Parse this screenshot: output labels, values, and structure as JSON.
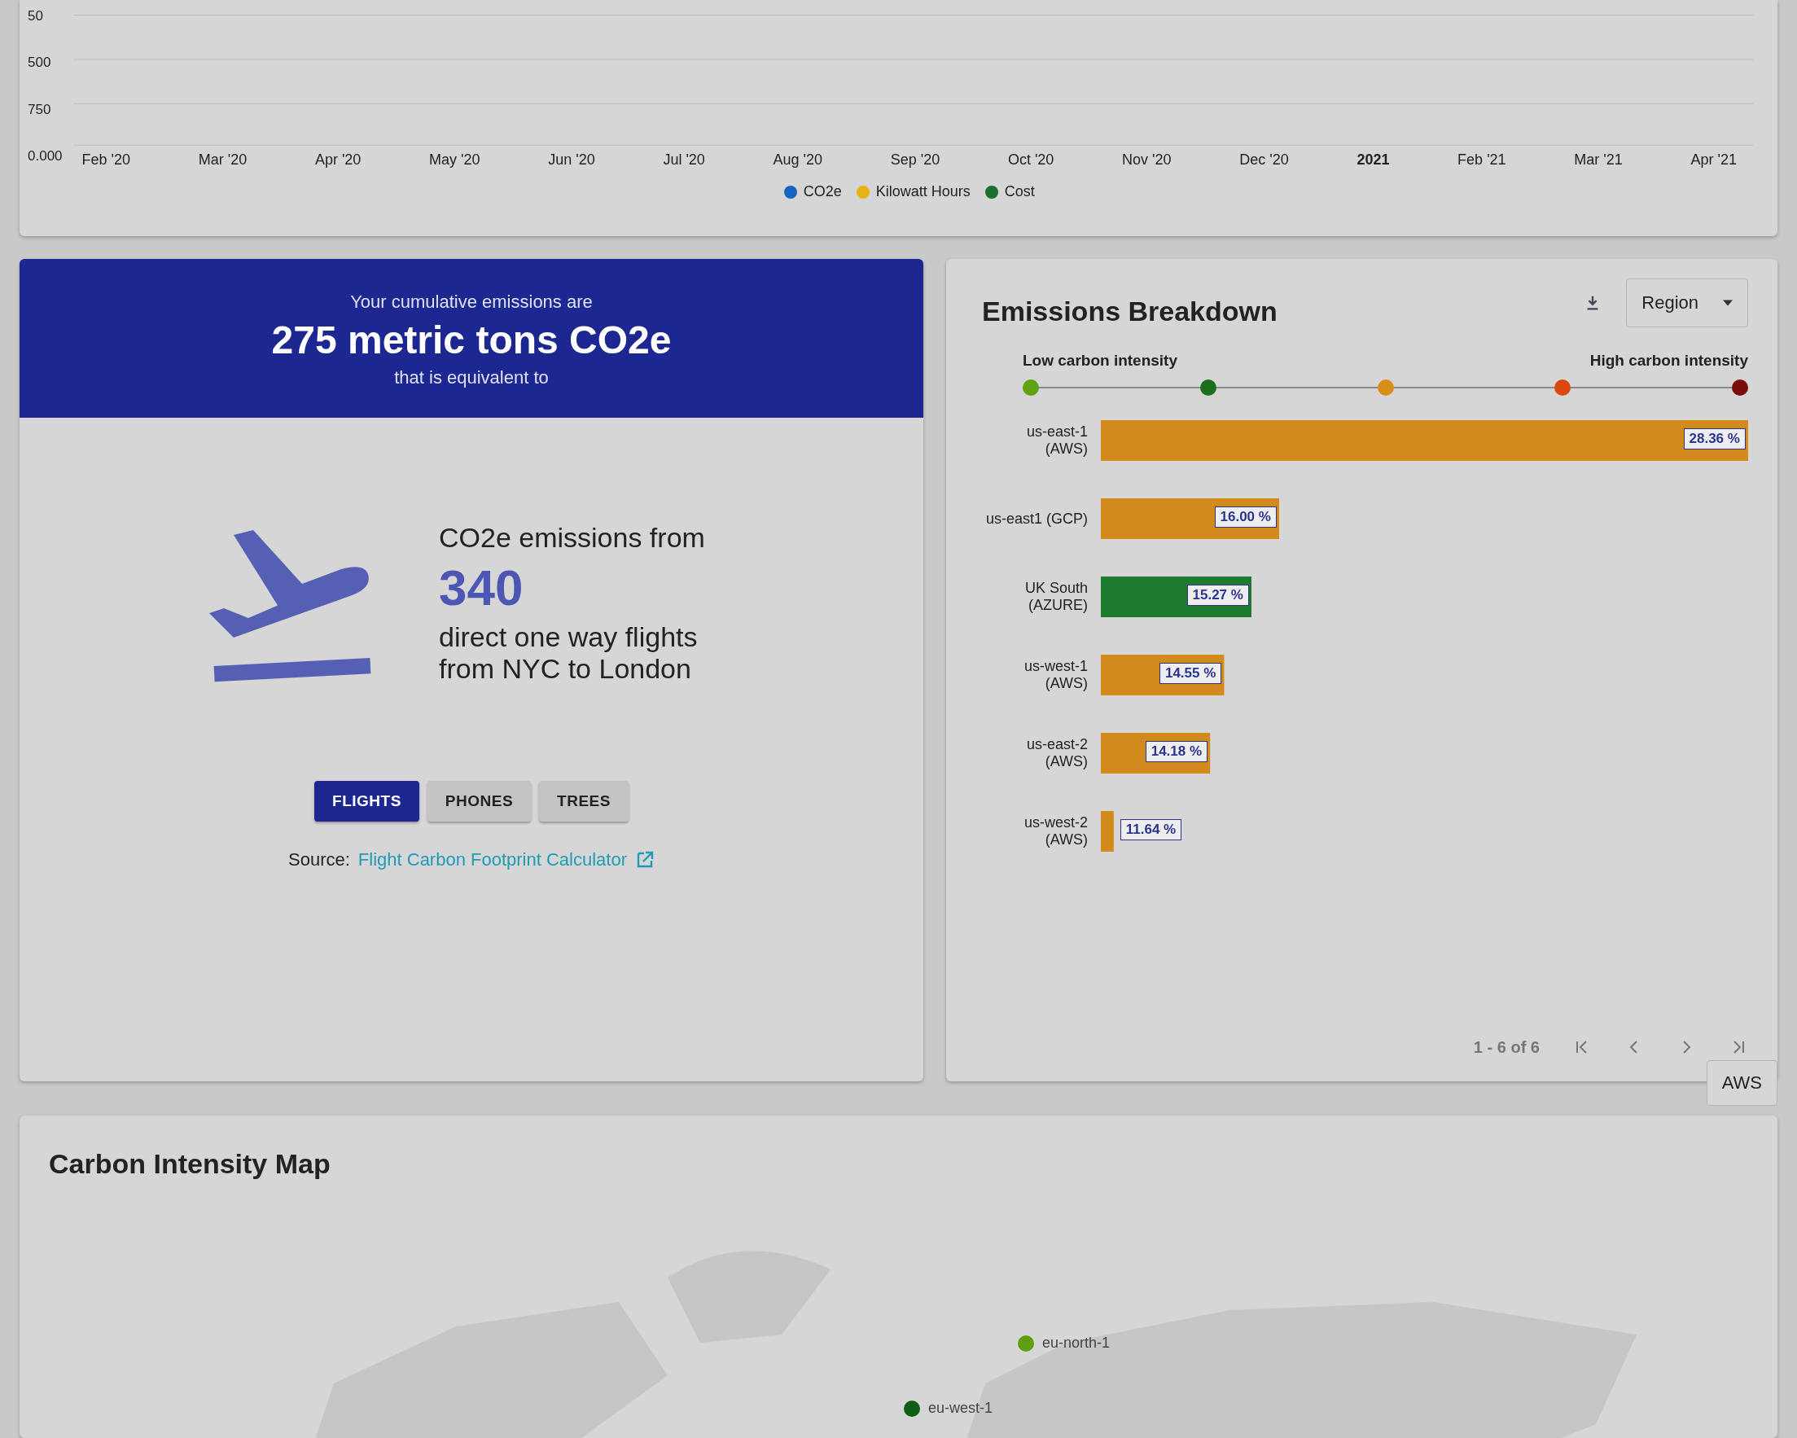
{
  "trend_chart": {
    "y_labels": [
      "50",
      "500",
      "750",
      "0.000"
    ],
    "x_labels": [
      {
        "text": "Feb '20",
        "bold": false
      },
      {
        "text": "Mar '20",
        "bold": false
      },
      {
        "text": "Apr '20",
        "bold": false
      },
      {
        "text": "May '20",
        "bold": false
      },
      {
        "text": "Jun '20",
        "bold": false
      },
      {
        "text": "Jul '20",
        "bold": false
      },
      {
        "text": "Aug '20",
        "bold": false
      },
      {
        "text": "Sep '20",
        "bold": false
      },
      {
        "text": "Oct '20",
        "bold": false
      },
      {
        "text": "Nov '20",
        "bold": false
      },
      {
        "text": "Dec '20",
        "bold": false
      },
      {
        "text": "2021",
        "bold": true
      },
      {
        "text": "Feb '21",
        "bold": false
      },
      {
        "text": "Mar '21",
        "bold": false
      },
      {
        "text": "Apr '21",
        "bold": false
      }
    ],
    "legend": [
      {
        "label": "CO2e",
        "color": "#1565c0"
      },
      {
        "label": "Kilowatt Hours",
        "color": "#e6b214"
      },
      {
        "label": "Cost",
        "color": "#1b6e2e"
      }
    ]
  },
  "equivalency": {
    "banner": {
      "intro": "Your cumulative emissions are",
      "total": "275 metric tons CO2e",
      "outro": "that is equivalent to"
    },
    "lead": "CO2e emissions from",
    "count": "340",
    "description": "direct one way flights from NYC to London",
    "tabs": [
      {
        "label": "FLIGHTS",
        "selected": true
      },
      {
        "label": "PHONES",
        "selected": false
      },
      {
        "label": "TREES",
        "selected": false
      }
    ],
    "source_label": "Source:",
    "source_link": "Flight Carbon Footprint Calculator"
  },
  "breakdown": {
    "title": "Emissions Breakdown",
    "dropdown": "Region",
    "scale": {
      "low_label": "Low carbon intensity",
      "high_label": "High carbon intensity",
      "dots": [
        {
          "color": "#5ea310"
        },
        {
          "color": "#1b6e1b"
        },
        {
          "color": "#d88f1a"
        },
        {
          "color": "#d9480f"
        },
        {
          "color": "#7a0c0c"
        }
      ]
    },
    "chart_data": {
      "type": "bar",
      "orientation": "horizontal",
      "categories": [
        "us-east-1 (AWS)",
        "us-east1 (GCP)",
        "UK South (AZURE)",
        "us-west-1 (AWS)",
        "us-east-2 (AWS)",
        "us-west-2 (AWS)"
      ],
      "values": [
        28.36,
        16.0,
        15.27,
        14.55,
        14.18,
        11.64
      ],
      "value_labels": [
        "28.36 %",
        "16.00 %",
        "15.27 %",
        "14.55 %",
        "14.18 %",
        "11.64 %"
      ],
      "colors": [
        "#d18a1b",
        "#d18a1b",
        "#1e7a2c",
        "#d18a1b",
        "#d18a1b",
        "#d18a1b"
      ],
      "xlim": [
        11.3,
        28.36
      ],
      "data_labels": true
    },
    "pagination": "1 - 6 of 6"
  },
  "map": {
    "title": "Carbon Intensity Map",
    "dropdown": "AWS",
    "markers": [
      {
        "label": "eu-north-1",
        "color": "#5e9e0f"
      },
      {
        "label": "eu-west-1",
        "color": "#0e5e14"
      }
    ]
  }
}
